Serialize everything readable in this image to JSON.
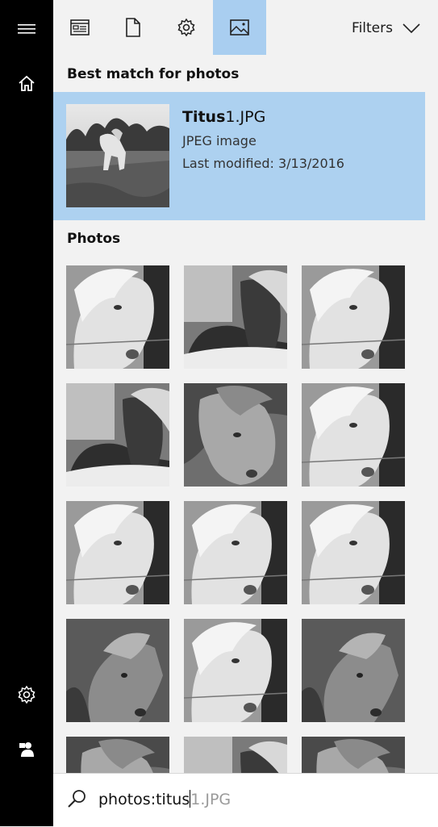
{
  "left_rail": {
    "items": [
      {
        "name": "hamburger-menu-icon"
      },
      {
        "name": "home-icon"
      },
      {
        "name": "settings-icon"
      },
      {
        "name": "feedback-icon"
      }
    ]
  },
  "tabs": [
    {
      "name": "tab-apps",
      "icon": "window-icon",
      "active": false
    },
    {
      "name": "tab-documents",
      "icon": "document-icon",
      "active": false
    },
    {
      "name": "tab-settings",
      "icon": "gear-icon",
      "active": false
    },
    {
      "name": "tab-photos",
      "icon": "image-icon",
      "active": true
    }
  ],
  "filters": {
    "label": "Filters"
  },
  "best_match": {
    "heading": "Best match for photos",
    "name_bold": "Titus",
    "name_rest": "1.JPG",
    "type": "JPEG image",
    "modified": "Last modified: 3/13/2016"
  },
  "photos": {
    "heading": "Photos",
    "items": [
      {
        "variant": "a"
      },
      {
        "variant": "b"
      },
      {
        "variant": "a"
      },
      {
        "variant": "b"
      },
      {
        "variant": "c"
      },
      {
        "variant": "a"
      },
      {
        "variant": "a"
      },
      {
        "variant": "a"
      },
      {
        "variant": "a"
      },
      {
        "variant": "d"
      },
      {
        "variant": "a"
      },
      {
        "variant": "d"
      },
      {
        "variant": "c"
      },
      {
        "variant": "b"
      },
      {
        "variant": "c"
      }
    ]
  },
  "search": {
    "typed": "photos:titus",
    "suggestion": "1.JPG"
  },
  "colors": {
    "left_rail": "#000000",
    "active_tab": "#a9cef0",
    "best_match_bg": "#add1f0",
    "background": "#f2f2f2"
  }
}
